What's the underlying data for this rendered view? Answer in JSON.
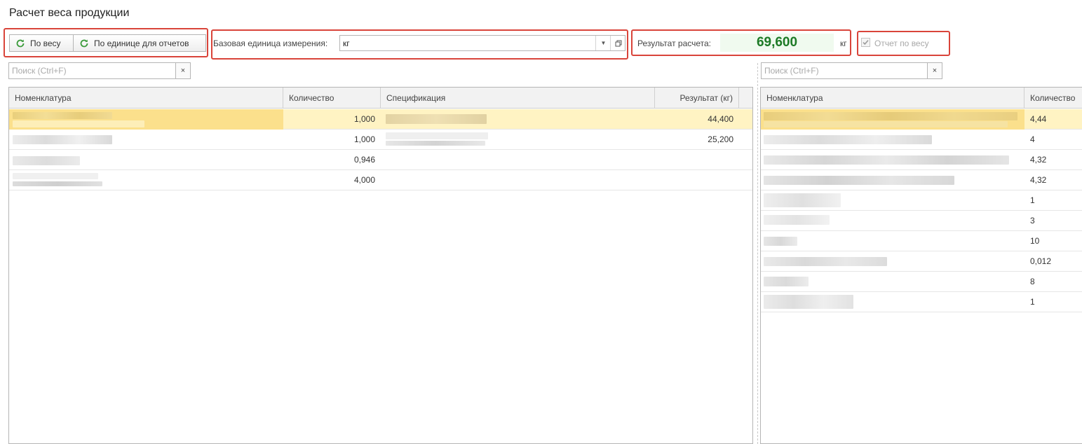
{
  "window": {
    "title": "Расчет веса продукции"
  },
  "toolbar": {
    "by_weight_label": "По весу",
    "by_report_unit_label": "По единице для отчетов"
  },
  "base_unit": {
    "label": "Базовая единица измерения:",
    "value": "кг"
  },
  "result": {
    "label": "Результат расчета:",
    "value": "69,600",
    "unit": "кг"
  },
  "report_by_weight": {
    "label": "Отчет по весу",
    "checked": true
  },
  "left_search": {
    "placeholder": "Поиск (Ctrl+F)",
    "clear": "×"
  },
  "right_search": {
    "placeholder": "Поиск (Ctrl+F)",
    "clear": "×"
  },
  "left_table": {
    "columns": [
      "Номенклатура",
      "Количество",
      "Спецификация",
      "Результат (кг)"
    ],
    "rows": [
      {
        "qty": "1,000",
        "result": "44,400"
      },
      {
        "qty": "1,000",
        "result": "25,200"
      },
      {
        "qty": "0,946",
        "result": ""
      },
      {
        "qty": "4,000",
        "result": ""
      }
    ]
  },
  "right_table": {
    "columns": [
      "Номенклатура",
      "Количество"
    ],
    "rows": [
      {
        "qty": "4,44"
      },
      {
        "qty": "4"
      },
      {
        "qty": "4,32"
      },
      {
        "qty": "4,32"
      },
      {
        "qty": "1"
      },
      {
        "qty": "3"
      },
      {
        "qty": "10"
      },
      {
        "qty": "0,012"
      },
      {
        "qty": "8"
      },
      {
        "qty": "1"
      }
    ]
  },
  "colors": {
    "highlight": "#d9443a",
    "accent_green": "#1d7a26",
    "selection": "#fff3c3"
  },
  "icons": {
    "refresh": "refresh-icon",
    "dropdown": "chevron-down-icon",
    "open": "open-form-icon",
    "checkbox": "checkbox-icon"
  }
}
